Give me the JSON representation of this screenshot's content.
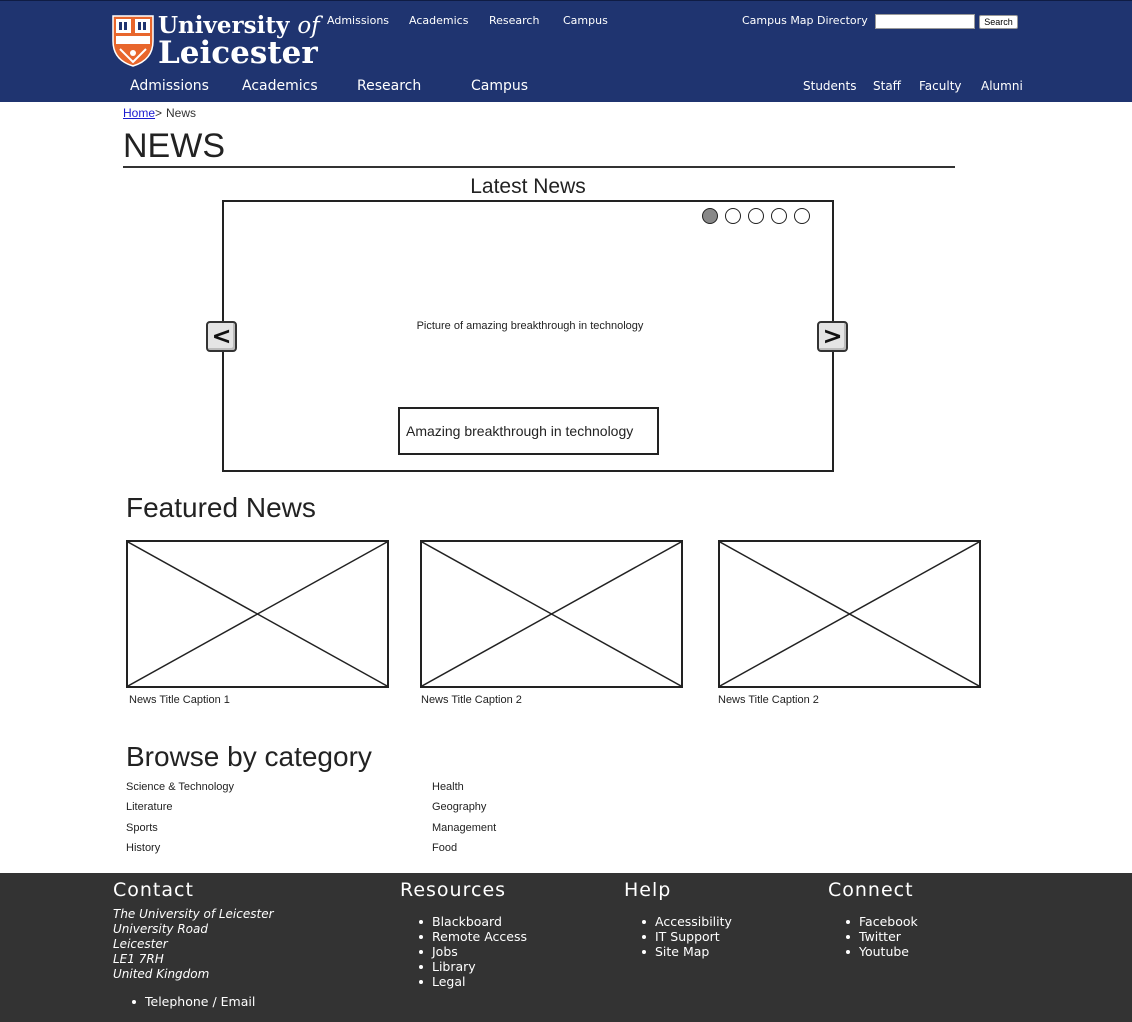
{
  "header": {
    "logo": {
      "line1": "University",
      "line1_of": "of",
      "line2": "Leicester"
    },
    "utility_links": [
      "Admissions",
      "Academics",
      "Research",
      "Campus"
    ],
    "right_links": [
      "Campus Map",
      "Directory"
    ],
    "search": {
      "value": "",
      "button_label": "Search"
    },
    "main_nav": [
      "Admissions",
      "Academics",
      "Research",
      "Campus"
    ],
    "audience_nav": [
      "Students",
      "Staff",
      "Faculty",
      "Alumni"
    ],
    "colors": {
      "header_bg": "#1f3470",
      "crest": "#e8662c"
    }
  },
  "breadcrumb": {
    "home": "Home",
    "separator": ">",
    "current": "News"
  },
  "page": {
    "title": "NEWS"
  },
  "latest": {
    "heading": "Latest News",
    "slide_count": 5,
    "active_slide": 1,
    "picture_text": "Picture of amazing breakthrough in technology",
    "caption": "Amazing breakthrough in technology",
    "prev_label": "<",
    "next_label": ">"
  },
  "featured": {
    "heading": "Featured News",
    "items": [
      {
        "caption": "News Title Caption 1"
      },
      {
        "caption": "News Title Caption 2"
      },
      {
        "caption": "News Title Caption 2"
      }
    ]
  },
  "browse": {
    "heading": "Browse by category",
    "left": [
      "Science & Technology",
      "Literature",
      "Sports",
      "History"
    ],
    "right": [
      "Health",
      "Geography",
      "Management",
      "Food"
    ]
  },
  "footer": {
    "contact": {
      "heading": "Contact",
      "address": [
        "The University of Leicester",
        "University Road",
        "Leicester",
        "LE1 7RH",
        "United Kingdom"
      ],
      "link": "Telephone / Email"
    },
    "resources": {
      "heading": "Resources",
      "items": [
        "Blackboard",
        "Remote Access",
        "Jobs",
        "Library",
        "Legal"
      ]
    },
    "help": {
      "heading": "Help",
      "items": [
        "Accessibility",
        "IT Support",
        "Site Map"
      ]
    },
    "connect": {
      "heading": "Connect",
      "items": [
        "Facebook",
        "Twitter",
        "Youtube"
      ]
    },
    "colors": {
      "footer_bg": "#333333"
    }
  }
}
